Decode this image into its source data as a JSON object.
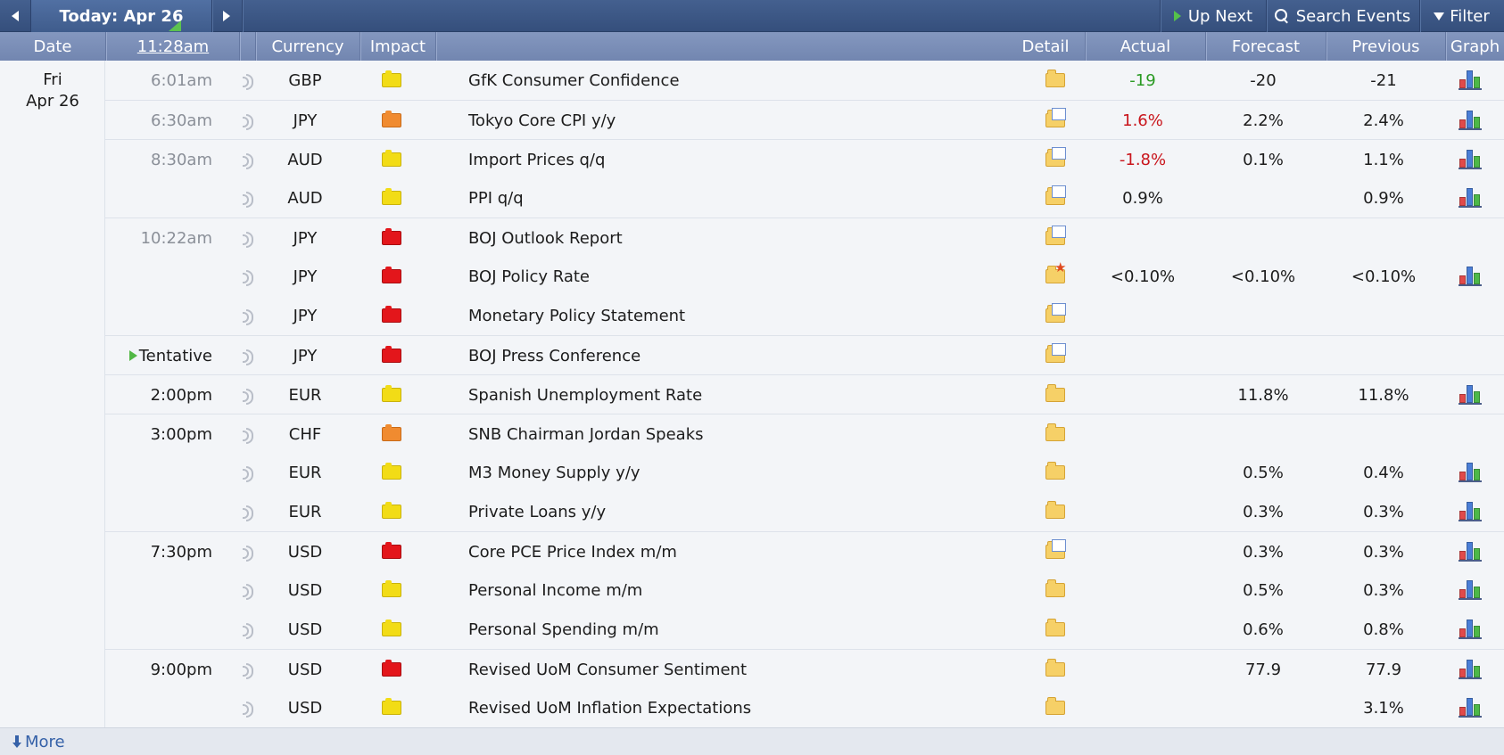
{
  "toolbar": {
    "today_label": "Today: Apr 26",
    "up_next_label": "Up Next",
    "search_label": "Search Events",
    "filter_label": "Filter"
  },
  "header": {
    "date": "Date",
    "time": "11:28am",
    "currency": "Currency",
    "impact": "Impact",
    "detail": "Detail",
    "actual": "Actual",
    "forecast": "Forecast",
    "previous": "Previous",
    "graph": "Graph"
  },
  "date": {
    "day": "Fri",
    "date": "Apr 26"
  },
  "colors": {
    "positive": "#2a9a23",
    "negative": "#c9151c",
    "high_impact": "#e3161b",
    "medium_impact": "#f08b30",
    "low_impact": "#f2dc16"
  },
  "events": [
    {
      "time": "6:01am",
      "currency": "GBP",
      "impact": "yellow",
      "event": "GfK Consumer Confidence",
      "detail": "folder",
      "actual": "-19",
      "actual_color": "green",
      "forecast": "-20",
      "previous": "-21",
      "graph": true
    },
    {
      "time": "6:30am",
      "currency": "JPY",
      "impact": "orange",
      "event": "Tokyo Core CPI y/y",
      "detail": "folder-doc",
      "actual": "1.6%",
      "actual_color": "red",
      "forecast": "2.2%",
      "previous": "2.4%",
      "graph": true
    },
    {
      "time": "8:30am",
      "currency": "AUD",
      "impact": "yellow",
      "event": "Import Prices q/q",
      "detail": "folder-doc",
      "actual": "-1.8%",
      "actual_color": "red",
      "forecast": "0.1%",
      "previous": "1.1%",
      "graph": true
    },
    {
      "time": "",
      "currency": "AUD",
      "impact": "yellow",
      "event": "PPI q/q",
      "detail": "folder-doc",
      "actual": "0.9%",
      "actual_color": "",
      "forecast": "",
      "previous": "0.9%",
      "graph": true
    },
    {
      "time": "10:22am",
      "currency": "JPY",
      "impact": "red",
      "event": "BOJ Outlook Report",
      "detail": "folder-doc",
      "actual": "",
      "actual_color": "",
      "forecast": "",
      "previous": "",
      "graph": false
    },
    {
      "time": "",
      "currency": "JPY",
      "impact": "red",
      "event": "BOJ Policy Rate",
      "detail": "folder-star",
      "actual": "<0.10%",
      "actual_color": "",
      "forecast": "<0.10%",
      "previous": "<0.10%",
      "graph": true
    },
    {
      "time": "",
      "currency": "JPY",
      "impact": "red",
      "event": "Monetary Policy Statement",
      "detail": "folder-doc",
      "actual": "",
      "actual_color": "",
      "forecast": "",
      "previous": "",
      "graph": false
    },
    {
      "time": "Tentative",
      "currency": "JPY",
      "impact": "red",
      "event": "BOJ Press Conference",
      "detail": "folder-doc",
      "actual": "",
      "actual_color": "",
      "forecast": "",
      "previous": "",
      "graph": false
    },
    {
      "time": "2:00pm",
      "currency": "EUR",
      "impact": "yellow",
      "event": "Spanish Unemployment Rate",
      "detail": "folder",
      "actual": "",
      "actual_color": "",
      "forecast": "11.8%",
      "previous": "11.8%",
      "graph": true
    },
    {
      "time": "3:00pm",
      "currency": "CHF",
      "impact": "orange",
      "event": "SNB Chairman Jordan Speaks",
      "detail": "folder",
      "actual": "",
      "actual_color": "",
      "forecast": "",
      "previous": "",
      "graph": false
    },
    {
      "time": "",
      "currency": "EUR",
      "impact": "yellow",
      "event": "M3 Money Supply y/y",
      "detail": "folder",
      "actual": "",
      "actual_color": "",
      "forecast": "0.5%",
      "previous": "0.4%",
      "graph": true
    },
    {
      "time": "",
      "currency": "EUR",
      "impact": "yellow",
      "event": "Private Loans y/y",
      "detail": "folder",
      "actual": "",
      "actual_color": "",
      "forecast": "0.3%",
      "previous": "0.3%",
      "graph": true
    },
    {
      "time": "7:30pm",
      "currency": "USD",
      "impact": "red",
      "event": "Core PCE Price Index m/m",
      "detail": "folder-doc",
      "actual": "",
      "actual_color": "",
      "forecast": "0.3%",
      "previous": "0.3%",
      "graph": true
    },
    {
      "time": "",
      "currency": "USD",
      "impact": "yellow",
      "event": "Personal Income m/m",
      "detail": "folder",
      "actual": "",
      "actual_color": "",
      "forecast": "0.5%",
      "previous": "0.3%",
      "graph": true
    },
    {
      "time": "",
      "currency": "USD",
      "impact": "yellow",
      "event": "Personal Spending m/m",
      "detail": "folder",
      "actual": "",
      "actual_color": "",
      "forecast": "0.6%",
      "previous": "0.8%",
      "graph": true
    },
    {
      "time": "9:00pm",
      "currency": "USD",
      "impact": "red",
      "event": "Revised UoM Consumer Sentiment",
      "detail": "folder",
      "actual": "",
      "actual_color": "",
      "forecast": "77.9",
      "previous": "77.9",
      "graph": true
    },
    {
      "time": "",
      "currency": "USD",
      "impact": "yellow",
      "event": "Revised UoM Inflation Expectations",
      "detail": "folder",
      "actual": "",
      "actual_color": "",
      "forecast": "",
      "previous": "3.1%",
      "graph": true
    }
  ],
  "footer": {
    "more_label": "More"
  }
}
